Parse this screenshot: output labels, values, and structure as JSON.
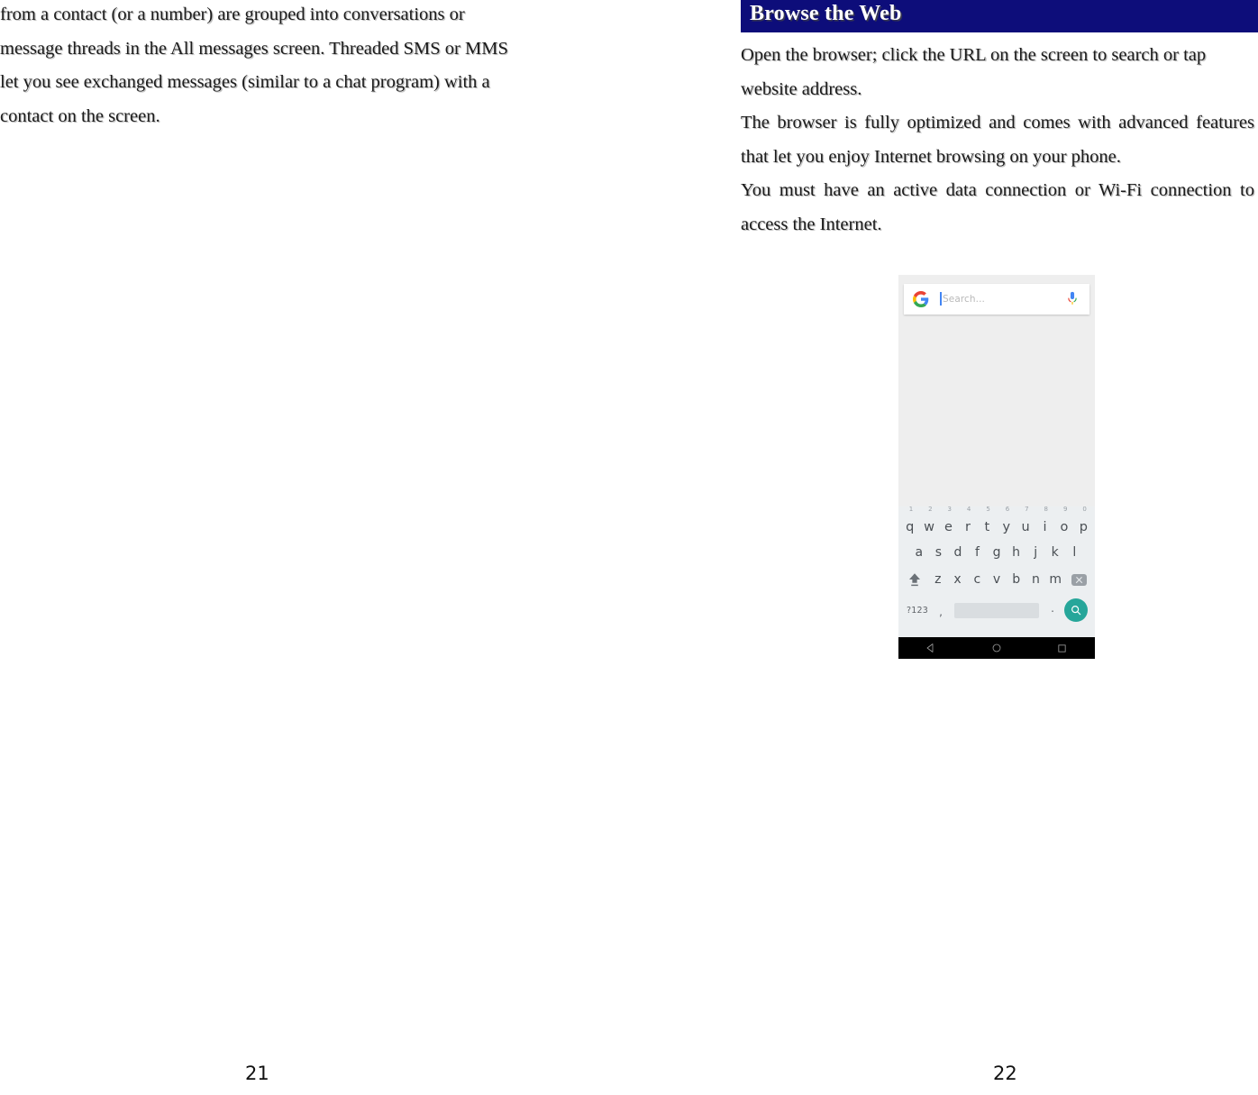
{
  "document": {
    "left_page": {
      "number": "21",
      "paragraphs": [
        "from a contact (or a number) are grouped into conversations or message threads in the All messages screen. Threaded SMS or MMS let you see exchanged messages (similar to a chat program) with a contact on the screen."
      ]
    },
    "right_page": {
      "number": "22",
      "section_title": "Browse the Web",
      "section_title_bg": "#0d0d7a",
      "paragraphs": [
        "Open the browser; click the URL on the screen to search or tap website address.",
        "The browser is fully optimized and comes with advanced features that let you enjoy Internet browsing on your phone.",
        "You must have an active data connection or Wi-Fi connection to access the Internet."
      ]
    }
  },
  "phone_screenshot": {
    "search_bar": {
      "logo_icon": "google-g-icon",
      "placeholder": "Search...",
      "caret_color": "#4285f4",
      "mic_icon": "microphone-icon"
    },
    "content_area_color": "#eeeeee",
    "keyboard": {
      "background_color": "#eceff1",
      "row1": [
        {
          "letter": "q",
          "number": "1"
        },
        {
          "letter": "w",
          "number": "2"
        },
        {
          "letter": "e",
          "number": "3"
        },
        {
          "letter": "r",
          "number": "4"
        },
        {
          "letter": "t",
          "number": "5"
        },
        {
          "letter": "y",
          "number": "6"
        },
        {
          "letter": "u",
          "number": "7"
        },
        {
          "letter": "i",
          "number": "8"
        },
        {
          "letter": "o",
          "number": "9"
        },
        {
          "letter": "p",
          "number": "0"
        }
      ],
      "row2": [
        "a",
        "s",
        "d",
        "f",
        "g",
        "h",
        "j",
        "k",
        "l"
      ],
      "row3": {
        "shift_icon": "shift-arrow-icon",
        "letters": [
          "z",
          "x",
          "c",
          "v",
          "b",
          "n",
          "m"
        ],
        "backspace_icon": "backspace-icon"
      },
      "row4": {
        "symbols_label": "?123",
        "comma_label": ",",
        "space_label": "",
        "period_label": ".",
        "search_icon": "search-magnifier-icon",
        "search_button_color": "#26a69a"
      }
    },
    "nav_bar": {
      "background_color": "#000000",
      "back_icon": "back-triangle-icon",
      "home_icon": "home-circle-icon",
      "recents_icon": "recents-square-icon"
    }
  }
}
